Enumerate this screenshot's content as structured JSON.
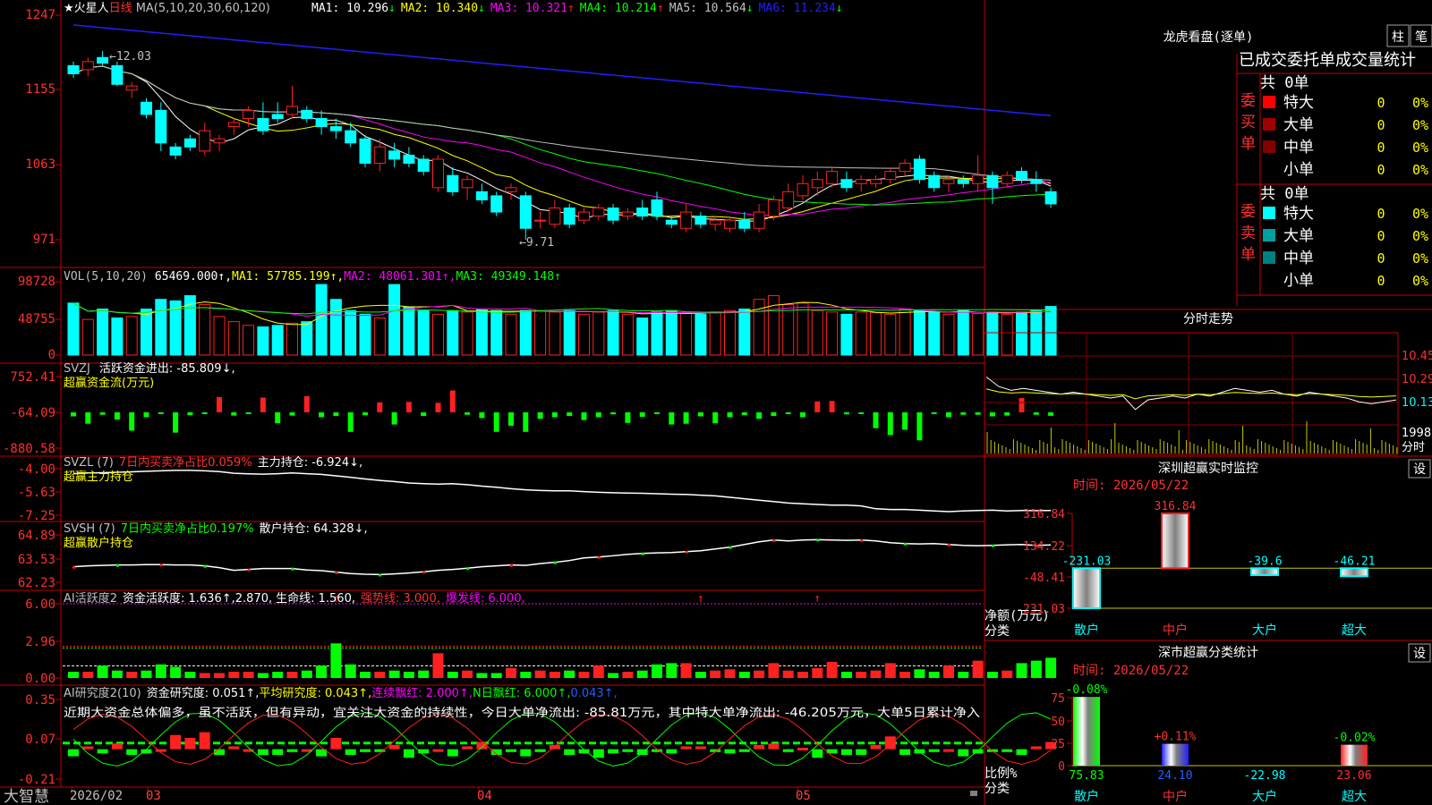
{
  "stock": {
    "star": "★",
    "name": "火星人",
    "period": "日线",
    "ma_label": "MA(5,10,20,30,60,120)",
    "ma_values": [
      {
        "label": "MA1:",
        "value": "10.296",
        "arrow": "↓",
        "color": "#ffffff"
      },
      {
        "label": "MA2:",
        "value": "10.340",
        "arrow": "↓",
        "color": "#ffff00"
      },
      {
        "label": "MA3:",
        "value": "10.321",
        "arrow": "↑",
        "color": "#ff00ff"
      },
      {
        "label": "MA4:",
        "value": "10.214",
        "arrow": "↑",
        "color": "#00ff00"
      },
      {
        "label": "MA5:",
        "value": "10.564",
        "arrow": "↓",
        "color": "#c0c0c0"
      },
      {
        "label": "MA6:",
        "value": "11.234",
        "arrow": "↓",
        "color": "#2020ff"
      }
    ],
    "high_label": "12.03",
    "low_label": "9.71"
  },
  "axes": {
    "price_ticks": [
      "1247",
      "1155",
      "1063",
      "971"
    ],
    "vol_ticks": [
      "98728",
      "48755",
      "0"
    ],
    "svzj_ticks": [
      "752.41",
      "-64.09",
      "-880.58"
    ],
    "svzl_ticks": [
      "-4.00",
      "-5.63",
      "-7.25"
    ],
    "svsh_ticks": [
      "64.89",
      "63.53",
      "62.23"
    ],
    "ai1_ticks": [
      "6.00",
      "2.96",
      "0.00"
    ],
    "ai2_ticks": [
      "0.35",
      "0.07",
      "-0.21"
    ],
    "x_labels": [
      {
        "text": "2026/02",
        "color": "#c0c0c0"
      },
      {
        "text": "03",
        "color": "#ff4040"
      },
      {
        "text": "04",
        "color": "#ff4040"
      },
      {
        "text": "05",
        "color": "#ff4040"
      }
    ],
    "brand": "大智慧"
  },
  "vol_header": {
    "name": "VOL(5,10,20)",
    "value": "65469.000↑,",
    "ma1": "MA1: 57785.199↑,",
    "ma2": "MA2: 48061.301↑,",
    "ma3": "MA3: 49349.148↑"
  },
  "svzj_header": {
    "name": "SVZJ",
    "text": "活跃资金进出: -85.809↓,",
    "sub": "超赢资金流(万元)"
  },
  "svzl_header": {
    "name": "SVZL (7)",
    "ratio": "7日内买卖净占比0.059%",
    "holding": "主力持仓: -6.924↓,",
    "sub": "超赢主力持仓"
  },
  "svsh_header": {
    "name": "SVSH (7)",
    "ratio": "7日内买卖净占比0.197%",
    "holding": "散户持仓: 64.328↓,",
    "sub": "超赢散户持仓"
  },
  "ai1_header": {
    "name": "AI活跃度2",
    "active": "资金活跃度: 1.636↑,",
    "v2": "2.870,",
    "life": "生命线: 1.560,",
    "strong": "强势线: 3.000,",
    "burst": "爆发线: 6.000,"
  },
  "ai2_header": {
    "name": "AI研究度2(10)",
    "research": "资金研究度: 0.051↑,",
    "avg": "平均研究度: 0.043↑,",
    "red": "连续飘红: 2.000↑,",
    "nday": "N日飘红: 6.000↑,",
    "tail": "0.043↑,",
    "commentary": "近期大资金总体偏多，虽不活跃，但有异动，宜关注大资金的持续性，今日大单净流出: -85.81万元，其中特大单净流出: -46.205万元，大单5日累计净入"
  },
  "right_panel": {
    "title": "龙虎看盘(逐单)",
    "btn_zhu": "柱",
    "btn_bi": "笔",
    "table_header": "已成交委托单成交量统计",
    "buy_label": "委买单",
    "sell_label": "委卖单",
    "buy_total": "共 0单",
    "sell_total": "共 0单",
    "buy_rows": [
      {
        "name": "特大",
        "count": "0",
        "pct": "0%",
        "color": "#ff0000"
      },
      {
        "name": "大单",
        "count": "0",
        "pct": "0%",
        "color": "#a00000"
      },
      {
        "name": "中单",
        "count": "0",
        "pct": "0%",
        "color": "#800000"
      },
      {
        "name": "小单",
        "count": "0",
        "pct": "0%",
        "color": "#000000"
      }
    ],
    "sell_rows": [
      {
        "name": "特大",
        "count": "0",
        "pct": "0%",
        "color": "#00ffff"
      },
      {
        "name": "大单",
        "count": "0",
        "pct": "0%",
        "color": "#00a0a0"
      },
      {
        "name": "中单",
        "count": "0",
        "pct": "0%",
        "color": "#008080"
      },
      {
        "name": "小单",
        "count": "0",
        "pct": "0%",
        "color": "#000000"
      }
    ],
    "intraday_title": "分时走势",
    "intraday_ticks": [
      "10.45",
      "10.29",
      "10.13",
      "1998",
      "分时"
    ],
    "monitor_title": "深圳超赢实时监控",
    "monitor_btn": "设",
    "monitor_time": "时间: 2026/05/22",
    "monitor_ticks": [
      "316.84",
      "134.22",
      "-48.41",
      "-231.03"
    ],
    "monitor_y_label": "净额(万元)",
    "monitor_x_label": "分类",
    "stats_title": "深市超赢分类统计",
    "stats_btn": "设",
    "stats_time": "时间: 2026/05/22",
    "stats_ticks": [
      "75",
      "50",
      "25",
      "0"
    ],
    "stats_y_label": "比例%",
    "stats_x_label": "分类"
  },
  "chart_data": [
    {
      "type": "candlestick",
      "title": "火星人 日线",
      "ylim": [
        9.71,
        12.47
      ],
      "ma_period_labels": [
        "MA1",
        "MA2",
        "MA3",
        "MA4",
        "MA5",
        "MA6"
      ],
      "high": 12.03,
      "low": 9.71,
      "ohlc": [
        [
          11.85,
          11.9,
          11.7,
          11.75
        ],
        [
          11.8,
          11.95,
          11.72,
          11.9
        ],
        [
          11.95,
          12.03,
          11.85,
          11.88
        ],
        [
          11.85,
          11.9,
          11.6,
          11.62
        ],
        [
          11.55,
          11.65,
          11.45,
          11.6
        ],
        [
          11.4,
          11.45,
          11.2,
          11.25
        ],
        [
          11.3,
          11.4,
          10.8,
          10.9
        ],
        [
          10.85,
          10.9,
          10.7,
          10.75
        ],
        [
          10.95,
          11.0,
          10.8,
          10.85
        ],
        [
          10.8,
          11.15,
          10.75,
          11.05
        ],
        [
          10.9,
          11.0,
          10.8,
          10.95
        ],
        [
          11.1,
          11.2,
          11.0,
          11.15
        ],
        [
          11.2,
          11.35,
          11.1,
          11.3
        ],
        [
          11.2,
          11.4,
          11.0,
          11.05
        ],
        [
          11.25,
          11.4,
          11.15,
          11.2
        ],
        [
          11.25,
          11.6,
          11.2,
          11.35
        ],
        [
          11.3,
          11.35,
          11.15,
          11.2
        ],
        [
          11.2,
          11.3,
          11.0,
          11.1
        ],
        [
          11.1,
          11.2,
          10.95,
          11.05
        ],
        [
          11.05,
          11.15,
          10.85,
          10.9
        ],
        [
          10.95,
          11.0,
          10.6,
          10.65
        ],
        [
          10.65,
          10.95,
          10.55,
          10.85
        ],
        [
          10.8,
          10.9,
          10.6,
          10.7
        ],
        [
          10.75,
          10.85,
          10.6,
          10.65
        ],
        [
          10.7,
          10.75,
          10.5,
          10.55
        ],
        [
          10.35,
          10.75,
          10.3,
          10.7
        ],
        [
          10.5,
          10.6,
          10.25,
          10.3
        ],
        [
          10.35,
          10.5,
          10.2,
          10.45
        ],
        [
          10.3,
          10.4,
          10.15,
          10.2
        ],
        [
          10.25,
          10.3,
          10.0,
          10.05
        ],
        [
          10.3,
          10.4,
          10.2,
          10.35
        ],
        [
          10.25,
          10.3,
          9.71,
          9.85
        ],
        [
          9.95,
          10.05,
          9.85,
          9.95
        ],
        [
          9.9,
          10.2,
          9.85,
          10.1
        ],
        [
          10.1,
          10.15,
          9.85,
          9.9
        ],
        [
          9.95,
          10.1,
          9.9,
          10.05
        ],
        [
          10.0,
          10.15,
          9.95,
          10.1
        ],
        [
          10.1,
          10.15,
          9.9,
          9.95
        ],
        [
          10.0,
          10.1,
          9.95,
          10.05
        ],
        [
          10.1,
          10.2,
          9.95,
          10.0
        ],
        [
          10.2,
          10.3,
          9.95,
          10.0
        ],
        [
          9.95,
          10.0,
          9.85,
          9.9
        ],
        [
          9.85,
          10.15,
          9.8,
          10.05
        ],
        [
          10.0,
          10.05,
          9.85,
          9.9
        ],
        [
          9.9,
          10.0,
          9.82,
          9.95
        ],
        [
          9.85,
          10.0,
          9.8,
          9.95
        ],
        [
          9.95,
          10.05,
          9.8,
          9.85
        ],
        [
          9.85,
          10.15,
          9.8,
          10.05
        ],
        [
          10.0,
          10.25,
          9.95,
          10.2
        ],
        [
          10.1,
          10.4,
          10.05,
          10.3
        ],
        [
          10.25,
          10.5,
          10.2,
          10.4
        ],
        [
          10.35,
          10.55,
          10.25,
          10.45
        ],
        [
          10.4,
          10.6,
          10.35,
          10.55
        ],
        [
          10.45,
          10.55,
          10.3,
          10.35
        ],
        [
          10.4,
          10.5,
          10.3,
          10.45
        ],
        [
          10.4,
          10.5,
          10.35,
          10.45
        ],
        [
          10.45,
          10.6,
          10.4,
          10.55
        ],
        [
          10.55,
          10.7,
          10.5,
          10.65
        ],
        [
          10.7,
          10.75,
          10.4,
          10.45
        ],
        [
          10.5,
          10.55,
          10.3,
          10.35
        ],
        [
          10.4,
          10.5,
          10.3,
          10.45
        ],
        [
          10.45,
          10.5,
          10.35,
          10.4
        ],
        [
          10.4,
          10.75,
          10.3,
          10.5
        ],
        [
          10.5,
          10.55,
          10.15,
          10.35
        ],
        [
          10.4,
          10.55,
          10.35,
          10.5
        ],
        [
          10.55,
          10.6,
          10.4,
          10.45
        ],
        [
          10.45,
          10.55,
          10.3,
          10.4
        ],
        [
          10.3,
          10.35,
          10.1,
          10.15
        ]
      ]
    },
    {
      "type": "bar",
      "title": "VOL(5,10,20)",
      "ylim": [
        0,
        98728
      ],
      "values": [
        70000,
        48000,
        62000,
        50000,
        52000,
        62000,
        75000,
        73000,
        80000,
        68000,
        52000,
        45000,
        40000,
        38000,
        40000,
        43000,
        45000,
        95000,
        75000,
        60000,
        55000,
        50000,
        95000,
        65000,
        60000,
        55000,
        60000,
        58000,
        62000,
        60000,
        55000,
        60000,
        60000,
        58000,
        60000,
        55000,
        58000,
        60000,
        55000,
        50000,
        58000,
        60000,
        57000,
        55000,
        58000,
        60000,
        62000,
        75000,
        80000,
        68000,
        70000,
        60000,
        58000,
        55000,
        58000,
        57000,
        55000,
        62000,
        60000,
        58000,
        55000,
        60000,
        56000,
        58000,
        55000,
        58000,
        60000,
        65469
      ]
    },
    {
      "type": "bar",
      "title": "SVZJ 活跃资金进出",
      "ylim": [
        -880.58,
        752.41
      ],
      "values": [
        -100,
        -280,
        -60,
        -180,
        -450,
        -120,
        -30,
        -500,
        -70,
        -40,
        320,
        -80,
        -30,
        310,
        -270,
        -80,
        340,
        -120,
        -90,
        -480,
        -70,
        210,
        -300,
        220,
        -90,
        200,
        460,
        -60,
        -140,
        -480,
        -330,
        -480,
        -160,
        -120,
        -90,
        -190,
        -120,
        -50,
        -260,
        -110,
        -40,
        -300,
        -280,
        -100,
        -270,
        -120,
        -70,
        -160,
        -90,
        -40,
        -120,
        230,
        240,
        -50,
        -30,
        -390,
        -560,
        -430,
        -690,
        -30,
        -120,
        -60,
        -60,
        -100,
        -80,
        300,
        -60,
        -85.809
      ]
    },
    {
      "type": "line",
      "title": "SVZL 主力持仓",
      "ylim": [
        -7.25,
        -4.0
      ],
      "values": [
        -4.35,
        -4.3,
        -4.28,
        -4.25,
        -4.22,
        -4.18,
        -4.15,
        -4.12,
        -4.12,
        -4.15,
        -4.2,
        -4.32,
        -4.36,
        -4.38,
        -4.35,
        -4.3,
        -4.35,
        -4.4,
        -4.5,
        -4.6,
        -4.72,
        -4.82,
        -4.9,
        -5.0,
        -5.05,
        -5.08,
        -5.05,
        -5.12,
        -5.22,
        -5.3,
        -5.4,
        -5.48,
        -5.52,
        -5.55,
        -5.55,
        -5.6,
        -5.65,
        -5.68,
        -5.7,
        -5.72,
        -5.75,
        -5.78,
        -5.8,
        -5.85,
        -5.9,
        -6.0,
        -6.1,
        -6.2,
        -6.3,
        -6.4,
        -6.45,
        -6.5,
        -6.55,
        -6.55,
        -6.6,
        -6.8,
        -6.85,
        -6.85,
        -6.9,
        -6.95,
        -7.0,
        -6.95,
        -6.92,
        -6.9,
        -6.95,
        -6.92,
        -6.93,
        -6.924
      ]
    },
    {
      "type": "line",
      "title": "SVSH 散户持仓",
      "ylim": [
        62.23,
        64.89
      ],
      "values": [
        63.1,
        63.15,
        63.18,
        63.2,
        63.2,
        63.22,
        63.22,
        63.2,
        63.2,
        63.15,
        63.05,
        62.9,
        62.95,
        63.0,
        63.0,
        63.0,
        62.92,
        62.88,
        62.8,
        62.72,
        62.68,
        62.66,
        62.7,
        62.75,
        62.82,
        62.9,
        62.95,
        63.02,
        63.1,
        63.15,
        63.2,
        63.18,
        63.28,
        63.35,
        63.45,
        63.6,
        63.65,
        63.72,
        63.8,
        63.85,
        63.88,
        63.9,
        63.95,
        64.0,
        64.1,
        64.2,
        64.35,
        64.5,
        64.6,
        64.55,
        64.6,
        64.62,
        64.6,
        64.58,
        64.6,
        64.55,
        64.45,
        64.4,
        64.38,
        64.4,
        64.35,
        64.3,
        64.28,
        64.3,
        64.33,
        64.35,
        64.3,
        64.328
      ]
    },
    {
      "type": "bar",
      "title": "AI活跃度2 资金活跃度",
      "ylim": [
        0,
        6.0
      ],
      "values": [
        0.5,
        0.5,
        1.0,
        0.6,
        0.5,
        0.6,
        1.1,
        0.9,
        0.5,
        0.4,
        0.4,
        0.5,
        0.5,
        0.4,
        0.5,
        0.5,
        0.6,
        1.0,
        2.8,
        1.1,
        0.5,
        0.5,
        0.6,
        0.5,
        0.6,
        2.0,
        0.5,
        0.6,
        0.4,
        0.4,
        0.8,
        0.5,
        0.6,
        0.5,
        0.6,
        0.5,
        1.0,
        0.4,
        0.5,
        0.6,
        1.1,
        1.2,
        1.2,
        0.5,
        0.6,
        0.7,
        0.5,
        0.6,
        1.2,
        0.6,
        0.5,
        0.8,
        1.3,
        0.5,
        0.5,
        0.6,
        1.2,
        0.5,
        0.7,
        0.5,
        1.0,
        0.5,
        1.4,
        0.5,
        0.6,
        1.2,
        1.4,
        1.636
      ],
      "life_line": 1.56,
      "strong_line": 3.0,
      "burst_line": 6.0
    },
    {
      "type": "bar",
      "title": "AI研究度2(10)",
      "ylim": [
        -0.21,
        0.35
      ],
      "values": [
        -0.05,
        0.02,
        -0.03,
        0.04,
        -0.04,
        -0.03,
        0.0,
        0.1,
        0.08,
        0.12,
        -0.04,
        0.02,
        0.0,
        -0.04,
        -0.04,
        -0.02,
        0.0,
        -0.05,
        0.08,
        -0.04,
        -0.02,
        -0.02,
        0.03,
        -0.06,
        -0.03,
        0.0,
        -0.05,
        0.02,
        0.05,
        -0.04,
        -0.02,
        -0.05,
        -0.02,
        0.03,
        -0.04,
        -0.03,
        -0.06,
        -0.03,
        -0.02,
        -0.04,
        -0.02,
        -0.03,
        0.02,
        0.02,
        -0.02,
        -0.03,
        -0.02,
        0.03,
        0.04,
        -0.02,
        0.01,
        -0.06,
        -0.03,
        -0.04,
        -0.04,
        0.03,
        0.09,
        -0.04,
        -0.03,
        -0.02,
        0.0,
        -0.05,
        -0.03,
        -0.02,
        -0.02,
        -0.04,
        0.02,
        0.051
      ]
    },
    {
      "type": "line",
      "title": "分时走势",
      "ylim": [
        9.97,
        10.45
      ],
      "values": [
        10.22,
        10.17,
        10.15,
        10.16,
        10.15,
        10.14,
        10.13,
        10.14,
        10.13,
        10.12,
        10.11,
        10.12,
        10.05,
        10.1,
        10.11,
        10.12,
        10.11,
        10.13,
        10.12,
        10.14,
        10.16,
        10.15,
        10.14,
        10.15,
        10.13,
        10.12,
        10.14,
        10.13,
        10.12,
        10.11,
        10.09,
        10.08,
        10.09,
        10.1
      ]
    },
    {
      "type": "bar",
      "title": "深圳超赢实时监控",
      "categories": [
        "散户",
        "中户",
        "大户",
        "超大"
      ],
      "values": [
        -231.03,
        316.84,
        -39.6,
        -46.21
      ],
      "ylim": [
        -231.03,
        316.84
      ]
    },
    {
      "type": "bar",
      "title": "深市超赢分类统计",
      "categories": [
        "散户",
        "中户",
        "大户",
        "超大"
      ],
      "values": [
        75.83,
        24.1,
        -22.98,
        23.06
      ],
      "changes": [
        "-0.08%",
        "+0.11%",
        "",
        "-0.02%"
      ],
      "ylim": [
        0,
        75
      ]
    }
  ]
}
